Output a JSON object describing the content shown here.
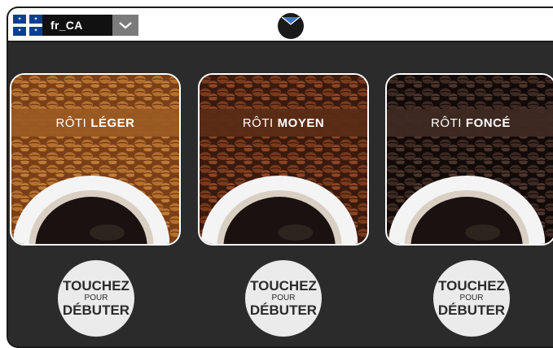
{
  "language": {
    "code": "fr_CA",
    "flag_icon": "quebec-flag-icon",
    "dropdown_icon": "chevron-down-icon"
  },
  "logo_icon": "brand-logo-icon",
  "colors": {
    "background": "#2b2b2b",
    "light_band": "#9a5a22",
    "medium_band": "#5a2c16",
    "dark_band": "#3e2a22",
    "button": "#ebebeb"
  },
  "roasts": [
    {
      "prefix": "RÔTI",
      "name": "LÉGER"
    },
    {
      "prefix": "RÔTI",
      "name": "MOYEN"
    },
    {
      "prefix": "RÔTI",
      "name": "FONCÉ"
    }
  ],
  "start_buttons": [
    {
      "line1": "TOUCHEZ",
      "line2": "POUR",
      "line3": "DÉBUTER"
    },
    {
      "line1": "TOUCHEZ",
      "line2": "POUR",
      "line3": "DÉBUTER"
    },
    {
      "line1": "TOUCHEZ",
      "line2": "POUR",
      "line3": "DÉBUTER"
    }
  ]
}
